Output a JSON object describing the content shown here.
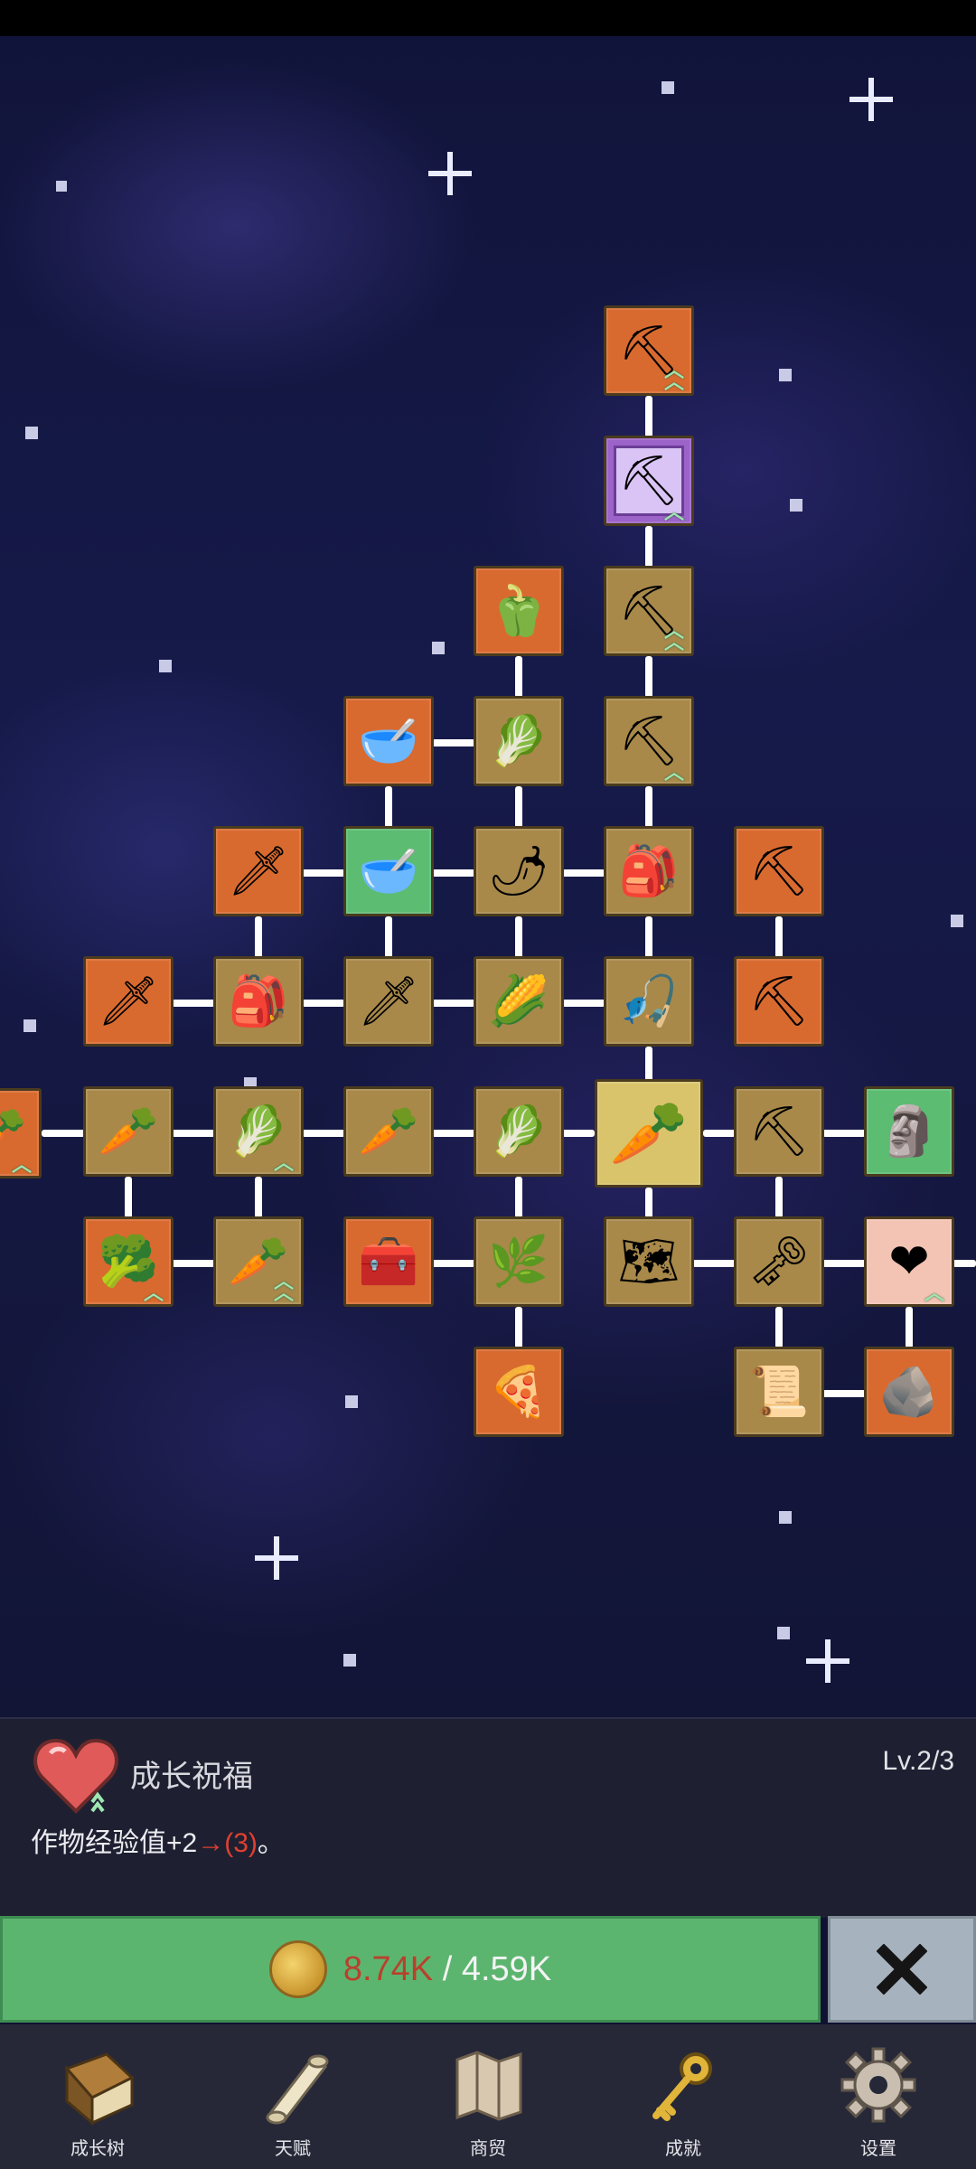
{
  "skill_tree": {
    "nodes": [
      {
        "id": "edge-carrot",
        "icon": "carrot-icon",
        "color": "orange"
      },
      {
        "id": "shovel-top",
        "icon": "shovel-icon",
        "color": "orange"
      },
      {
        "id": "shovel-magic",
        "icon": "shovel-icon",
        "color": "purple"
      },
      {
        "id": "pepper",
        "icon": "bell-pepper-icon",
        "color": "orange"
      },
      {
        "id": "shovel-2",
        "icon": "shovel-icon",
        "color": "olive"
      },
      {
        "id": "bowl-top",
        "icon": "bowl-icon",
        "color": "orange"
      },
      {
        "id": "radish",
        "icon": "radish-icon",
        "color": "olive"
      },
      {
        "id": "shovel-3",
        "icon": "shovel-icon",
        "color": "olive"
      },
      {
        "id": "sword-gold",
        "icon": "sword-icon",
        "color": "orange"
      },
      {
        "id": "bowl-green",
        "icon": "bowl-icon",
        "color": "green"
      },
      {
        "id": "chili",
        "icon": "chili-icon",
        "color": "olive"
      },
      {
        "id": "backpack-1",
        "icon": "backpack-icon",
        "color": "olive"
      },
      {
        "id": "pickaxe-top",
        "icon": "pickaxe-icon",
        "color": "orange"
      },
      {
        "id": "sword-left",
        "icon": "sword-icon",
        "color": "orange"
      },
      {
        "id": "backpack-2",
        "icon": "backpack-icon",
        "color": "olive"
      },
      {
        "id": "sword-mid",
        "icon": "sword-icon",
        "color": "olive"
      },
      {
        "id": "corn",
        "icon": "corn-icon",
        "color": "olive"
      },
      {
        "id": "fishing-rod",
        "icon": "rod-icon",
        "color": "olive"
      },
      {
        "id": "pickaxe-2",
        "icon": "pickaxe-icon",
        "color": "orange"
      },
      {
        "id": "carrot-1",
        "icon": "carrot-icon",
        "color": "olive"
      },
      {
        "id": "cabbage-1",
        "icon": "cabbage-icon",
        "color": "olive"
      },
      {
        "id": "carrot-2",
        "icon": "carrot-icon",
        "color": "olive"
      },
      {
        "id": "cabbage-2",
        "icon": "cabbage-icon",
        "color": "olive"
      },
      {
        "id": "carrot-root",
        "icon": "carrot-icon",
        "color": "gold"
      },
      {
        "id": "pickaxe-3",
        "icon": "pickaxe-icon",
        "color": "olive"
      },
      {
        "id": "statue",
        "icon": "statue-icon",
        "color": "green"
      },
      {
        "id": "broccoli",
        "icon": "broccoli-icon",
        "color": "orange"
      },
      {
        "id": "carrot-3",
        "icon": "carrot-icon",
        "color": "olive"
      },
      {
        "id": "chest",
        "icon": "treasure-chest-icon",
        "color": "orange"
      },
      {
        "id": "leek",
        "icon": "leek-icon",
        "color": "olive"
      },
      {
        "id": "map",
        "icon": "map-icon",
        "color": "olive"
      },
      {
        "id": "key",
        "icon": "key-icon",
        "color": "olive"
      },
      {
        "id": "heart",
        "icon": "heart-icon",
        "color": "pink"
      },
      {
        "id": "pizza",
        "icon": "pizza-icon",
        "color": "orange"
      },
      {
        "id": "scroll",
        "icon": "scroll-icon",
        "color": "olive"
      },
      {
        "id": "stone",
        "icon": "stone-icon",
        "color": "orange"
      }
    ]
  },
  "detail": {
    "icon": "heart-icon",
    "title": "成长祝福",
    "level": "Lv.2/3",
    "desc_prefix": "作物经验值+2",
    "desc_arrow": "→",
    "desc_next": "(3)",
    "desc_suffix": "。"
  },
  "upgrade": {
    "coin_icon": "coin-icon",
    "current": "8.74K",
    "separator": " / ",
    "required": "4.59K"
  },
  "close_icon": "close-icon",
  "nav": [
    {
      "label": "成长树",
      "icon": "book-icon"
    },
    {
      "label": "天赋",
      "icon": "scroll-icon"
    },
    {
      "label": "商贸",
      "icon": "map-icon"
    },
    {
      "label": "成就",
      "icon": "key-icon"
    },
    {
      "label": "设置",
      "icon": "gear-icon"
    }
  ],
  "colors": {
    "orange_tile": "#d96a2f",
    "olive_tile": "#a8894a",
    "green_tile": "#5cbc72",
    "purple_tile": "#9c63c9",
    "gold_tile": "#d9c46b",
    "upgrade_green": "#5cb56f",
    "coin_red": "#b9402c"
  }
}
